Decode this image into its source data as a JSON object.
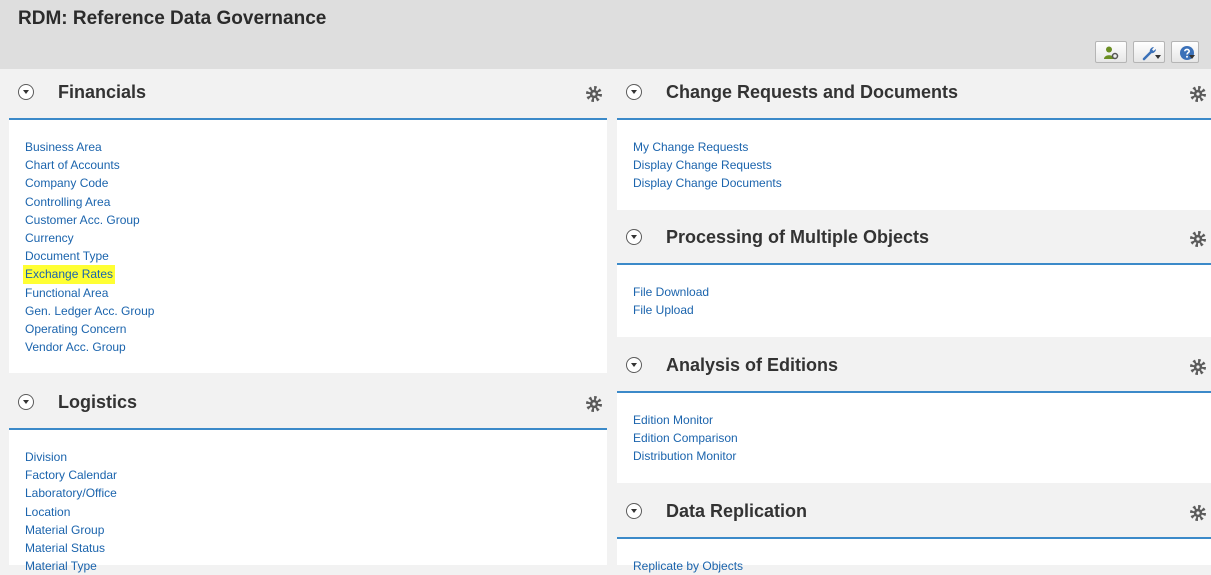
{
  "app": {
    "title": "RDM: Reference Data Governance"
  },
  "toolbar": {
    "buttons": [
      {
        "icon": "user-settings-icon"
      },
      {
        "icon": "wrench-icon"
      },
      {
        "icon": "help-icon"
      }
    ]
  },
  "panels": {
    "financials": {
      "title": "Financials",
      "links": [
        "Business Area",
        "Chart of Accounts",
        "Company Code",
        "Controlling Area",
        "Customer Acc. Group",
        "Currency",
        "Document Type",
        "Exchange Rates",
        "Functional Area",
        "Gen. Ledger Acc. Group",
        "Operating Concern",
        "Vendor Acc. Group"
      ],
      "highlighted": "Exchange Rates"
    },
    "logistics": {
      "title": "Logistics",
      "links": [
        "Division",
        "Factory Calendar",
        "Laboratory/Office",
        "Location",
        "Material Group",
        "Material Status",
        "Material Type"
      ]
    },
    "change_requests": {
      "title": "Change Requests and Documents",
      "links": [
        "My Change Requests",
        "Display Change Requests",
        "Display Change Documents"
      ]
    },
    "multiple_objects": {
      "title": "Processing of Multiple Objects",
      "links": [
        "File Download",
        "File Upload"
      ]
    },
    "editions": {
      "title": "Analysis of Editions",
      "links": [
        "Edition Monitor",
        "Edition Comparison",
        "Distribution Monitor"
      ]
    },
    "replication": {
      "title": "Data Replication",
      "links": [
        "Replicate by Objects"
      ]
    }
  },
  "colors": {
    "link": "#1b64ad",
    "accent": "#3c8ac9",
    "highlight": "#ffff33"
  }
}
